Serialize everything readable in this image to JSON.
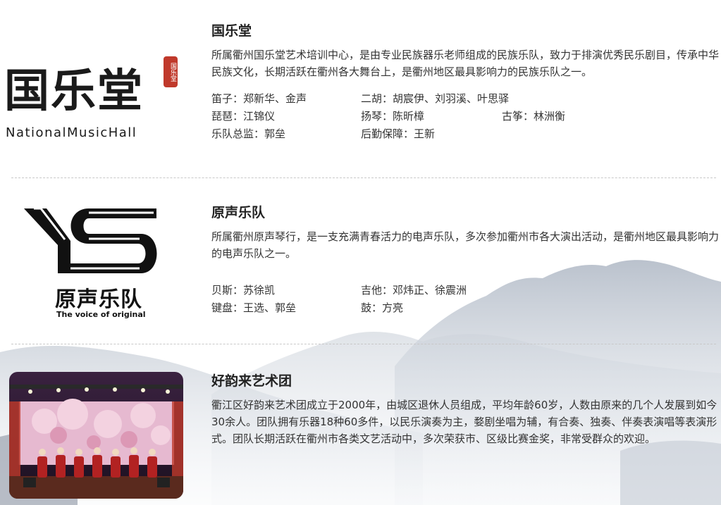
{
  "sections": [
    {
      "title": "国乐堂",
      "description": "所属衢州国乐堂艺术培训中心，是由专业民族器乐老师组成的民族乐队，致力于排演优秀民乐剧目，传承中华民族文化，长期活跃在衢州各大舞台上，是衢州地区最具影响力的民族乐队之一。",
      "logo": {
        "brush_text": "国乐堂",
        "seal_text": "国乐堂",
        "english": "NationalMusicHall"
      },
      "members": [
        [
          "笛子：郑新华、金声",
          "二胡：胡宸伊、刘羽溪、叶思驿",
          ""
        ],
        [
          "琵琶：江锦仪",
          "扬琴：陈昕樟",
          "古筝：林洲衡"
        ],
        [
          "乐队总监：郭垒",
          "后勤保障：王新",
          ""
        ]
      ]
    },
    {
      "title": "原声乐队",
      "description": "所属衢州原声琴行，是一支充满青春活力的电声乐队，多次参加衢州市各大演出活动，是衢州地区最具影响力的电声乐队之一。",
      "logo": {
        "monogram": "YS",
        "chinese": "原声乐队",
        "english": "The voice of original"
      },
      "members": [
        [
          "贝斯：苏徐凯",
          "吉他：邓炜正、徐震洲",
          ""
        ],
        [
          "键盘：王选、郭垒",
          "鼓：方亮",
          ""
        ]
      ]
    },
    {
      "title": "好韵来艺术团",
      "description": "衢江区好韵来艺术团成立于2000年，由城区退休人员组成，平均年龄60岁，人数由原来的几个人发展到如今30余人。团队拥有乐器18种60多件，以民乐演奏为主，婺剧坐唱为辅，有合奏、独奏、伴奏表演唱等表演形式。团队长期活跃在衢州市各类文艺活动中，多次荣获市、区级比赛金奖，非常受群众的欢迎。"
    }
  ],
  "colors": {
    "seal_red": "#c0392b",
    "mountain_grey": "#b8c0cc",
    "text": "#333333",
    "title": "#222222"
  }
}
